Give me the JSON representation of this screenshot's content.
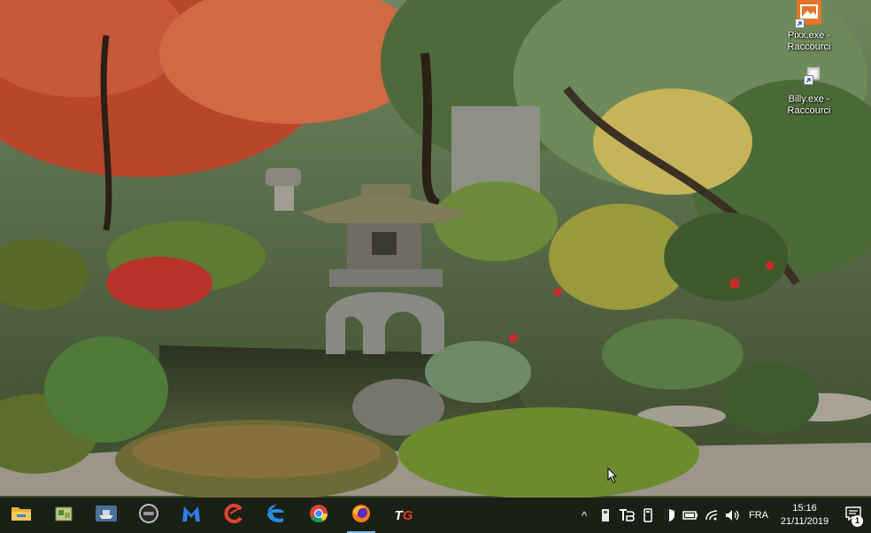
{
  "desktop": {
    "icons": [
      {
        "name": "pixx-shortcut",
        "label_line1": "Pixx.exe -",
        "label_line2": "Raccourci",
        "icon": "image-app-icon",
        "color": "#e8742a"
      },
      {
        "name": "billy-shortcut",
        "label_line1": "Billy.exe -",
        "label_line2": "Raccourci",
        "icon": "generic-app-icon",
        "color": "#d8d8d8"
      }
    ]
  },
  "taskbar": {
    "pinned": [
      {
        "name": "file-explorer",
        "icon": "folder-icon"
      },
      {
        "name": "app-2",
        "icon": "green-box-icon"
      },
      {
        "name": "app-3",
        "icon": "ship-icon"
      },
      {
        "name": "app-4",
        "icon": "circle-app-icon"
      },
      {
        "name": "app-5",
        "icon": "malwarebytes-icon"
      },
      {
        "name": "ccleaner",
        "icon": "ccleaner-icon"
      },
      {
        "name": "edge",
        "icon": "edge-icon"
      },
      {
        "name": "chrome",
        "icon": "chrome-icon"
      },
      {
        "name": "firefox",
        "icon": "firefox-icon",
        "active": true
      },
      {
        "name": "app-10",
        "icon": "tg-icon",
        "label": "TG"
      }
    ],
    "tray": {
      "chevron": "^",
      "language": "FRA",
      "time": "15:16",
      "date": "21/11/2019",
      "notification_count": "1"
    }
  },
  "colors": {
    "taskbar_bg": "#181c16",
    "active_indicator": "#76b9ed"
  }
}
